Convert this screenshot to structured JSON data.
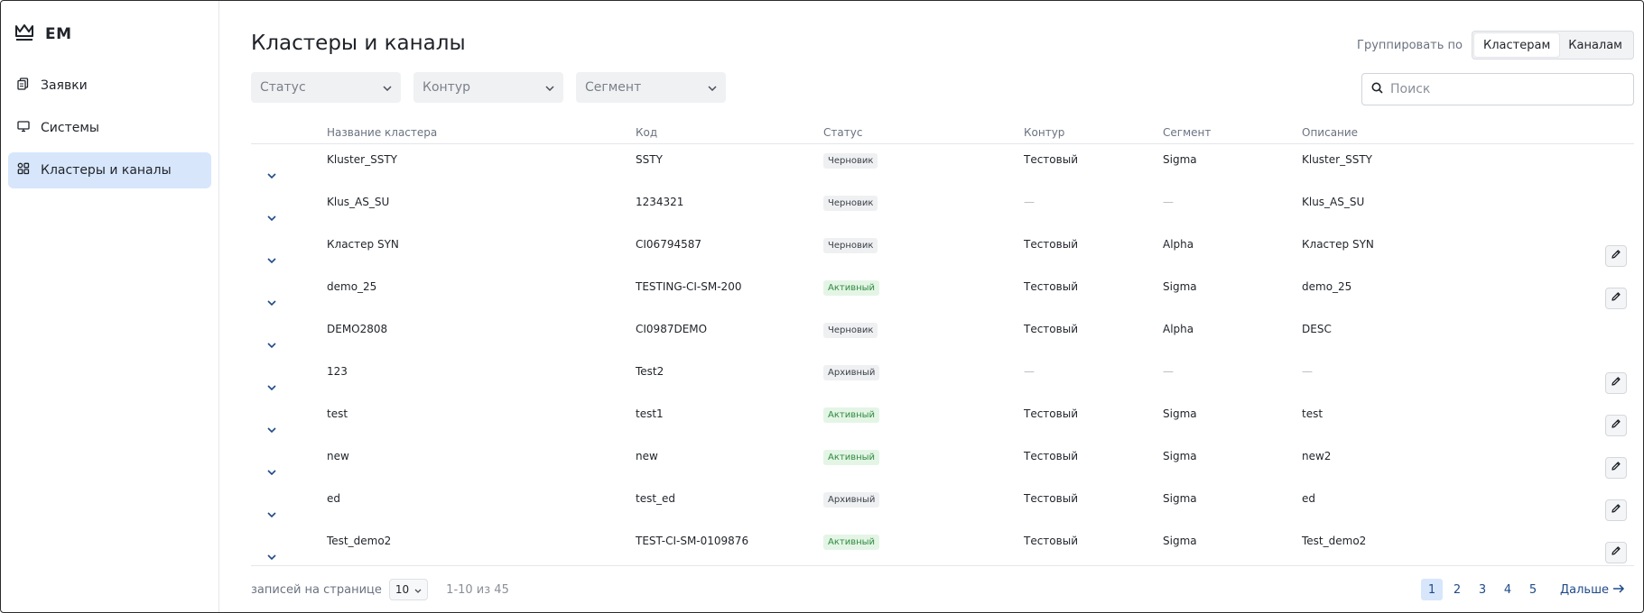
{
  "app": {
    "logo_text": "EM"
  },
  "sidebar": {
    "items": [
      {
        "label": "Заявки",
        "icon": "files-icon"
      },
      {
        "label": "Системы",
        "icon": "monitor-icon"
      },
      {
        "label": "Кластеры и каналы",
        "icon": "grid-icon",
        "active": true
      }
    ]
  },
  "header": {
    "title": "Кластеры и каналы",
    "group_label": "Группировать по",
    "group_options": [
      "Кластерам",
      "Каналам"
    ],
    "group_selected": "Кластерам"
  },
  "filters": {
    "status": "Статус",
    "contour": "Контур",
    "segment": "Сегмент"
  },
  "search": {
    "placeholder": "Поиск",
    "value": ""
  },
  "table": {
    "columns": [
      "Название кластера",
      "Код",
      "Статус",
      "Контур",
      "Сегмент",
      "Описание"
    ],
    "rows": [
      {
        "name": "Kluster_SSTY",
        "code": "SSTY",
        "status": "Черновик",
        "contour": "Тестовый",
        "segment": "Sigma",
        "desc": "Kluster_SSTY",
        "editable": false
      },
      {
        "name": "Klus_AS_SU",
        "code": "1234321",
        "status": "Черновик",
        "contour": "—",
        "segment": "—",
        "desc": "Klus_AS_SU",
        "editable": false
      },
      {
        "name": "Кластер SYN",
        "code": "CI06794587",
        "status": "Черновик",
        "contour": "Тестовый",
        "segment": "Alpha",
        "desc": "Кластер SYN",
        "editable": true
      },
      {
        "name": "demo_25",
        "code": "TESTING-CI-SM-200",
        "status": "Активный",
        "contour": "Тестовый",
        "segment": "Sigma",
        "desc": "demo_25",
        "editable": true
      },
      {
        "name": "DEMO2808",
        "code": "CI0987DEMO",
        "status": "Черновик",
        "contour": "Тестовый",
        "segment": "Alpha",
        "desc": "DESC",
        "editable": false
      },
      {
        "name": "123",
        "code": "Test2",
        "status": "Архивный",
        "contour": "—",
        "segment": "—",
        "desc": "—",
        "editable": true
      },
      {
        "name": "test",
        "code": "test1",
        "status": "Активный",
        "contour": "Тестовый",
        "segment": "Sigma",
        "desc": "test",
        "editable": true
      },
      {
        "name": "new",
        "code": "new",
        "status": "Активный",
        "contour": "Тестовый",
        "segment": "Sigma",
        "desc": "new2",
        "editable": true
      },
      {
        "name": "ed",
        "code": "test_ed",
        "status": "Архивный",
        "contour": "Тестовый",
        "segment": "Sigma",
        "desc": "ed",
        "editable": true
      },
      {
        "name": "Test_demo2",
        "code": "TEST-CI-SM-0109876",
        "status": "Активный",
        "contour": "Тестовый",
        "segment": "Sigma",
        "desc": "Test_demo2",
        "editable": true
      }
    ]
  },
  "footer": {
    "per_page_label": "записей на странице",
    "per_page_value": "10",
    "range_text": "1-10 из 45",
    "pages": [
      "1",
      "2",
      "3",
      "4",
      "5"
    ],
    "current_page": "1",
    "next_label": "Дальше"
  },
  "colors": {
    "accent": "#1f4a8a",
    "active_nav_bg": "#d7e6fb",
    "badge_active_text": "#2f8a3e",
    "badge_active_bg": "#e4f5e6"
  }
}
